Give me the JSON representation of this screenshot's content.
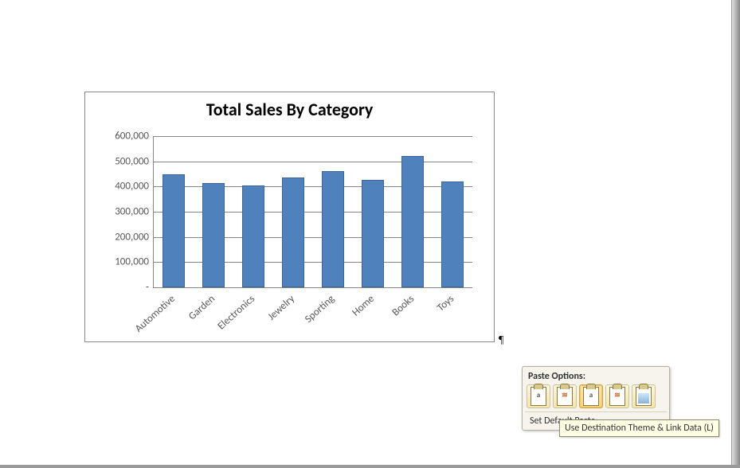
{
  "chart_data": {
    "type": "bar",
    "title": "Total Sales By Category",
    "categories": [
      "Automotive",
      "Garden",
      "Electronics",
      "Jewelry",
      "Sporting",
      "Home",
      "Books",
      "Toys"
    ],
    "values": [
      450000,
      415000,
      405000,
      435000,
      460000,
      425000,
      520000,
      420000
    ],
    "ylabel": "",
    "xlabel": "",
    "ylim": [
      0,
      600000
    ],
    "ytick_step": 100000,
    "ytick_labels": [
      "-",
      "100,000",
      "200,000",
      "300,000",
      "400,000",
      "500,000",
      "600,000"
    ],
    "bar_color": "#4f81bd"
  },
  "paragraph_mark": "¶",
  "paste_popup": {
    "title": "Paste Options:",
    "icons": [
      {
        "name": "paste-use-destination-theme-embed",
        "glyph": "a"
      },
      {
        "name": "paste-keep-source-formatting-embed",
        "glyph": "≋"
      },
      {
        "name": "paste-use-destination-theme-link",
        "glyph": "a",
        "selected": true
      },
      {
        "name": "paste-keep-source-formatting-link",
        "glyph": "≋"
      },
      {
        "name": "paste-as-picture",
        "glyph": ""
      }
    ],
    "default_label": "Set Default Paste...",
    "tooltip": "Use Destination Theme & Link Data (L)"
  }
}
